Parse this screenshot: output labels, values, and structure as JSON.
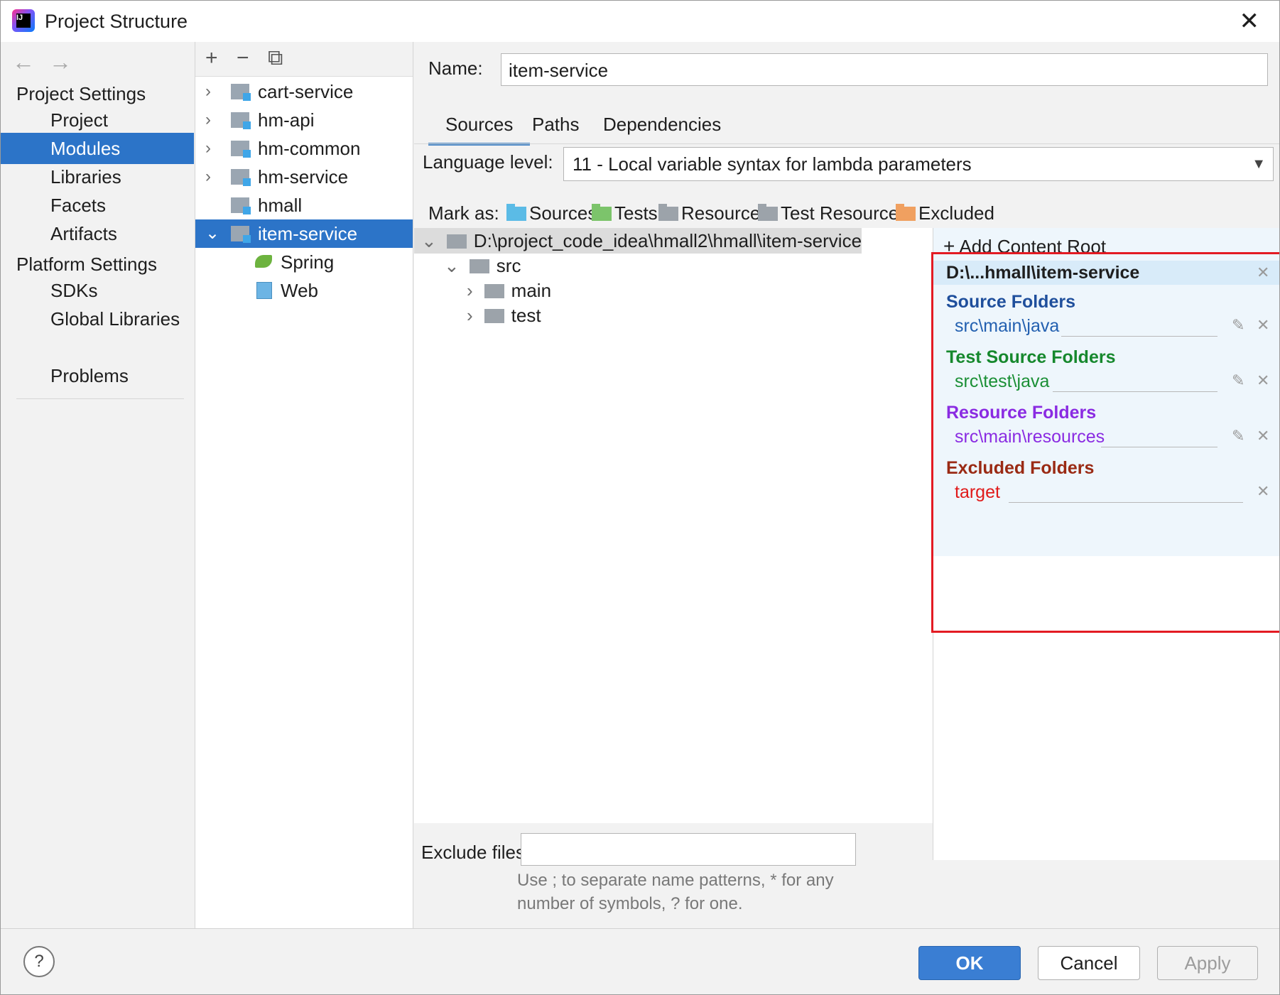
{
  "window": {
    "title": "Project Structure"
  },
  "nav": {
    "project_settings": "Project Settings",
    "items": [
      "Project",
      "Modules",
      "Libraries",
      "Facets",
      "Artifacts"
    ],
    "platform_settings": "Platform Settings",
    "platform_items": [
      "SDKs",
      "Global Libraries"
    ],
    "problems": "Problems",
    "selected": "Modules"
  },
  "modules": {
    "toolbar": {
      "add": "+",
      "remove": "−",
      "copy": "⧉"
    },
    "tree": [
      "cart-service",
      "hm-api",
      "hm-common",
      "hm-service",
      "hmall",
      "item-service"
    ],
    "children": [
      "Spring",
      "Web"
    ],
    "selected": "item-service"
  },
  "detail": {
    "name_label": "Name:",
    "name_value": "item-service",
    "tabs": [
      "Sources",
      "Paths",
      "Dependencies"
    ],
    "active_tab": "Sources",
    "language_label": "Language level:",
    "language_value": "11 - Local variable syntax for lambda parameters",
    "mark_as_label": "Mark as:",
    "mark_as": [
      {
        "label": "Sources",
        "color": "#5bbbe6"
      },
      {
        "label": "Tests",
        "color": "#7cc46b"
      },
      {
        "label": "Resources",
        "color": "#9ca3aa"
      },
      {
        "label": "Test Resources",
        "color": "#9ca3aa"
      },
      {
        "label": "Excluded",
        "color": "#f0a060"
      }
    ],
    "content_tree": {
      "root": "D:\\project_code_idea\\hmall2\\hmall\\item-service",
      "src": "src",
      "main": "main",
      "test": "test"
    },
    "exclude_label": "Exclude files:",
    "exclude_hint_1": "Use ; to separate name patterns, * for any",
    "exclude_hint_2": "number of symbols, ? for one."
  },
  "content_root": {
    "add_label": "Add Content Root",
    "root_path": "D:\\...hmall\\item-service",
    "sections": [
      {
        "heading": "Source Folders",
        "path": "src\\main\\java",
        "color": "#1f4f9c",
        "path_color": "#2360b0"
      },
      {
        "heading": "Test Source Folders",
        "path": "src\\test\\java",
        "color": "#16882d",
        "path_color": "#1a8f35"
      },
      {
        "heading": "Resource Folders",
        "path": "src\\main\\resources",
        "color": "#8a2be2",
        "path_color": "#8a2be2"
      },
      {
        "heading": "Excluded Folders",
        "path": "target",
        "color": "#9a2a14",
        "path_color": "#e01a1a"
      }
    ]
  },
  "buttons": {
    "help": "?",
    "ok": "OK",
    "cancel": "Cancel",
    "apply": "Apply"
  },
  "accent": {
    "selection": "#2c74c8",
    "highlight_box": "#e31b23"
  }
}
